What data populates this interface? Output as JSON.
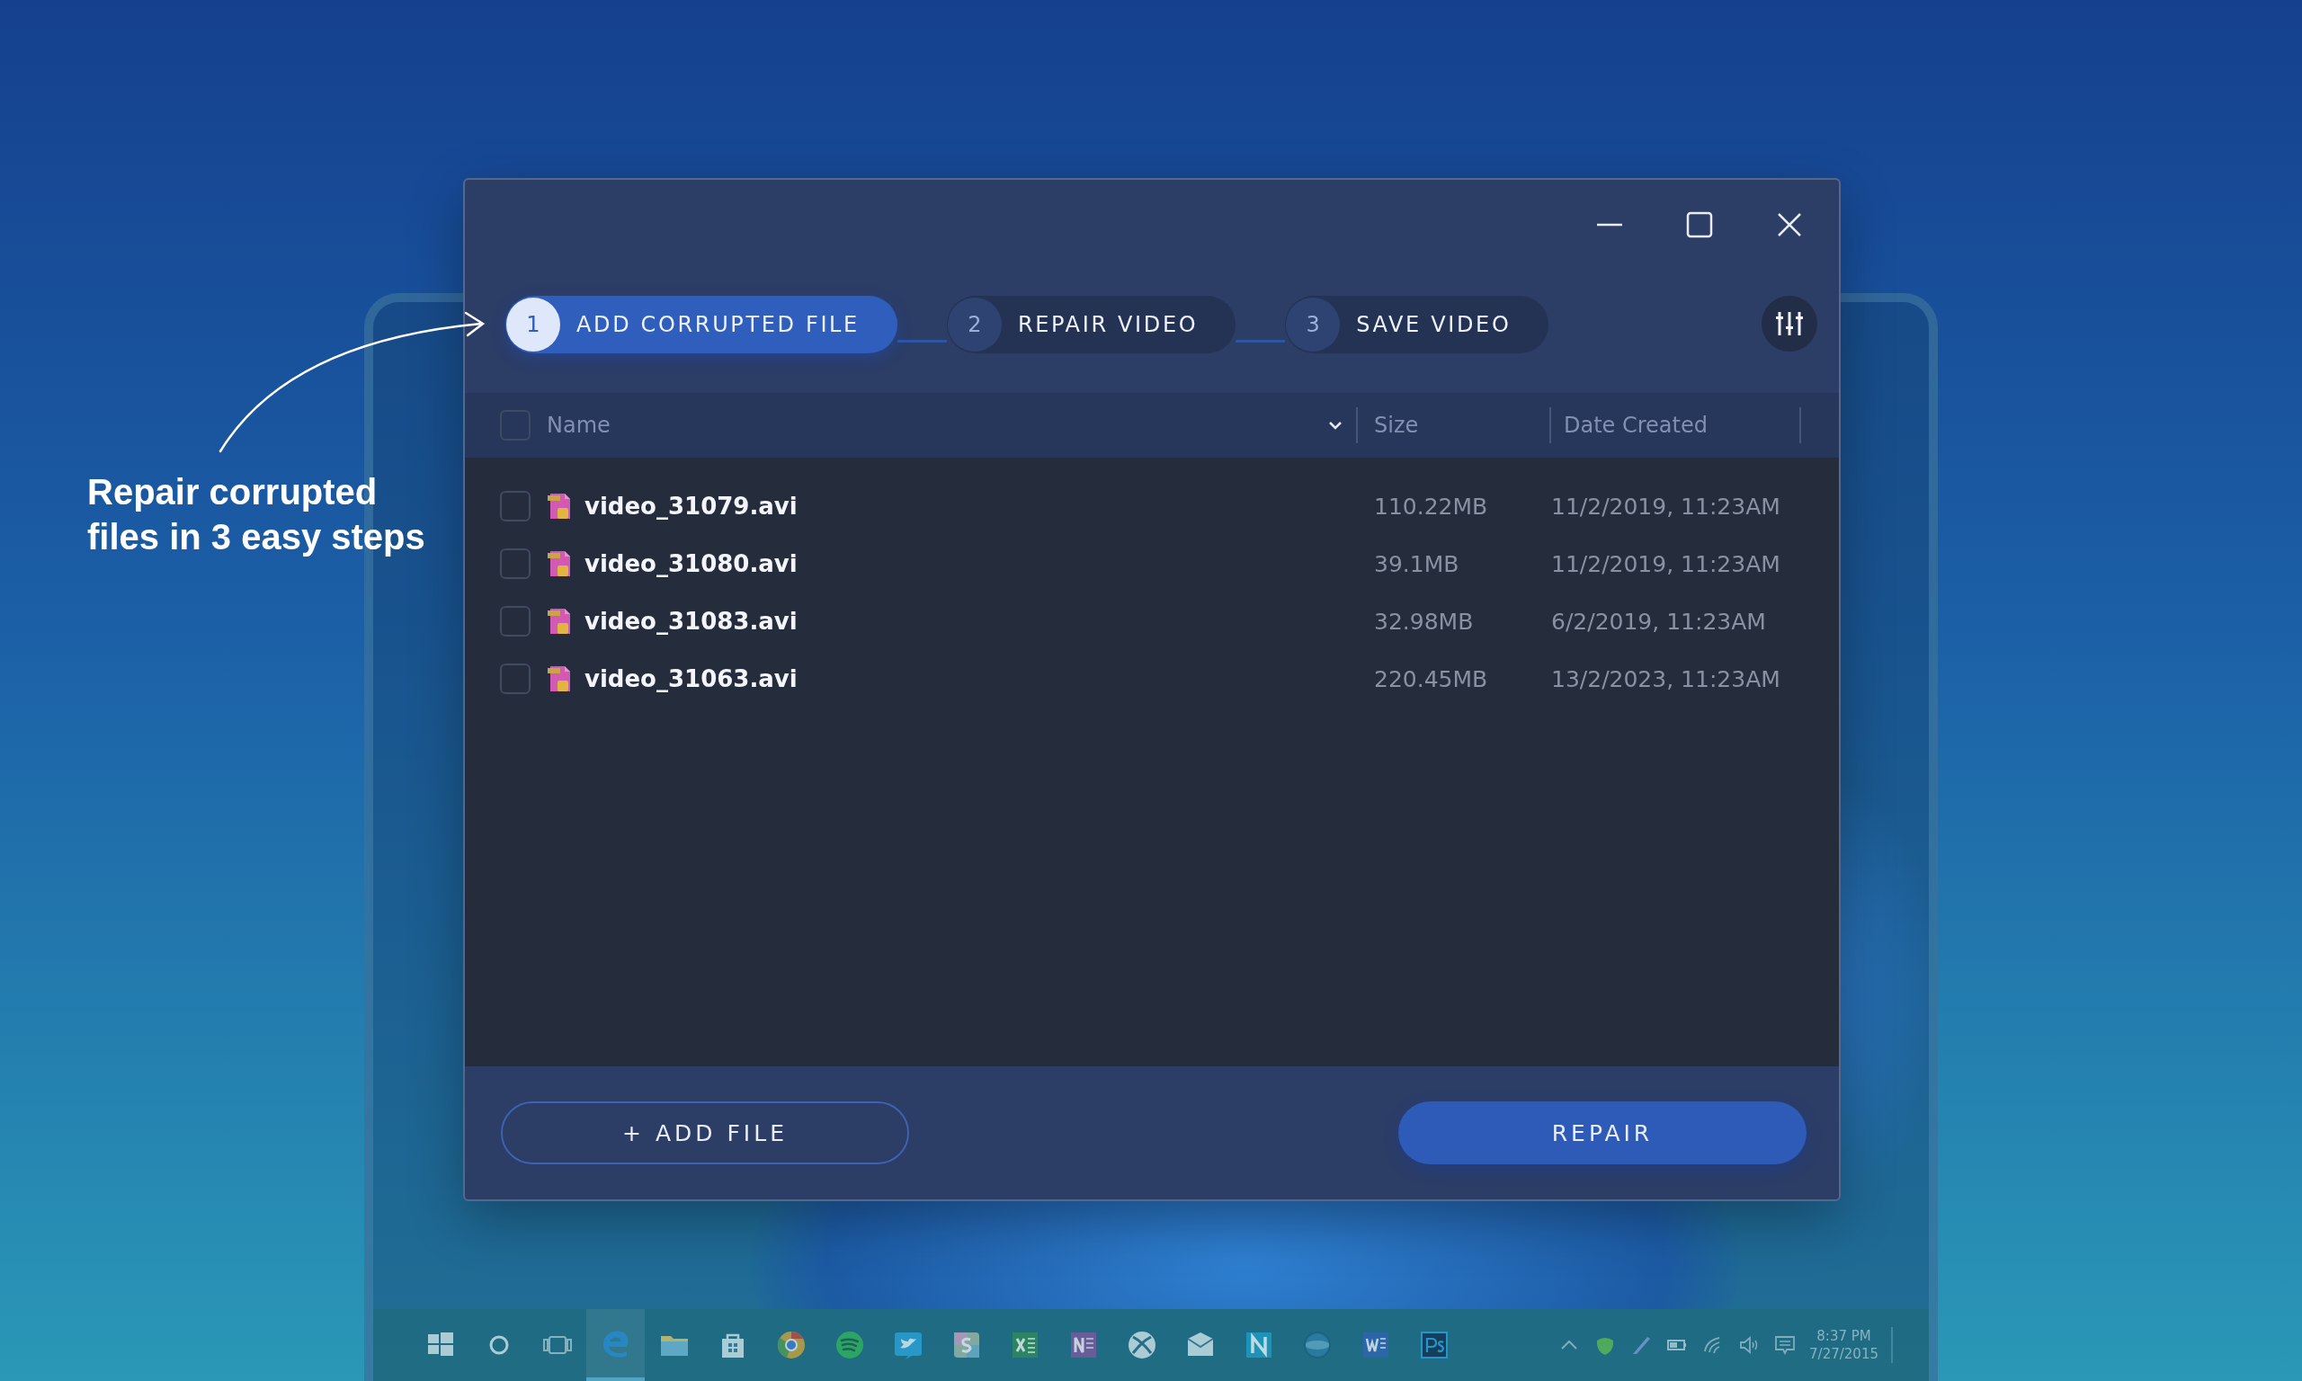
{
  "annotation": {
    "text": "Repair corrupted files in 3 easy steps"
  },
  "steps": [
    {
      "number": "1",
      "label": "ADD CORRUPTED FILE",
      "selected": true
    },
    {
      "number": "2",
      "label": "REPAIR VIDEO",
      "selected": false
    },
    {
      "number": "3",
      "label": "SAVE VIDEO",
      "selected": false
    }
  ],
  "table": {
    "select_all": {
      "checked": false
    },
    "columns": [
      "Name",
      "Size",
      "Date Created"
    ],
    "rows": [
      {
        "name": "video_31079.avi",
        "size": "110.22MB",
        "date": "11/2/2019, 11:23AM",
        "checked": false
      },
      {
        "name": "video_31080.avi",
        "size": "39.1MB",
        "date": "11/2/2019, 11:23AM",
        "checked": false
      },
      {
        "name": "video_31083.avi",
        "size": "32.98MB",
        "date": "6/2/2019, 11:23AM",
        "checked": false
      },
      {
        "name": "video_31063.avi",
        "size": "220.45MB",
        "date": "13/2/2023, 11:23AM",
        "checked": false
      }
    ]
  },
  "buttons": {
    "add_file": "+ ADD FILE",
    "repair": "REPAIR"
  },
  "taskbar": {
    "apps": [
      {
        "kind": "windows",
        "active": false
      },
      {
        "kind": "search",
        "active": false
      },
      {
        "kind": "taskview",
        "active": false
      },
      {
        "kind": "edge",
        "active": true
      },
      {
        "kind": "folder",
        "active": false
      },
      {
        "kind": "store",
        "active": false
      },
      {
        "kind": "chrome",
        "active": false
      },
      {
        "kind": "spotify",
        "active": false
      },
      {
        "kind": "twitter",
        "active": false
      },
      {
        "kind": "slack",
        "active": false
      },
      {
        "kind": "excel",
        "active": false
      },
      {
        "kind": "onenote",
        "active": false
      },
      {
        "kind": "xbox",
        "active": false
      },
      {
        "kind": "mail",
        "active": false
      },
      {
        "kind": "napp",
        "active": false
      },
      {
        "kind": "globe",
        "active": false
      },
      {
        "kind": "word",
        "active": false
      },
      {
        "kind": "photoshop",
        "active": false
      }
    ],
    "clock": {
      "time": "8:37 PM",
      "date": "7/27/2015"
    }
  }
}
